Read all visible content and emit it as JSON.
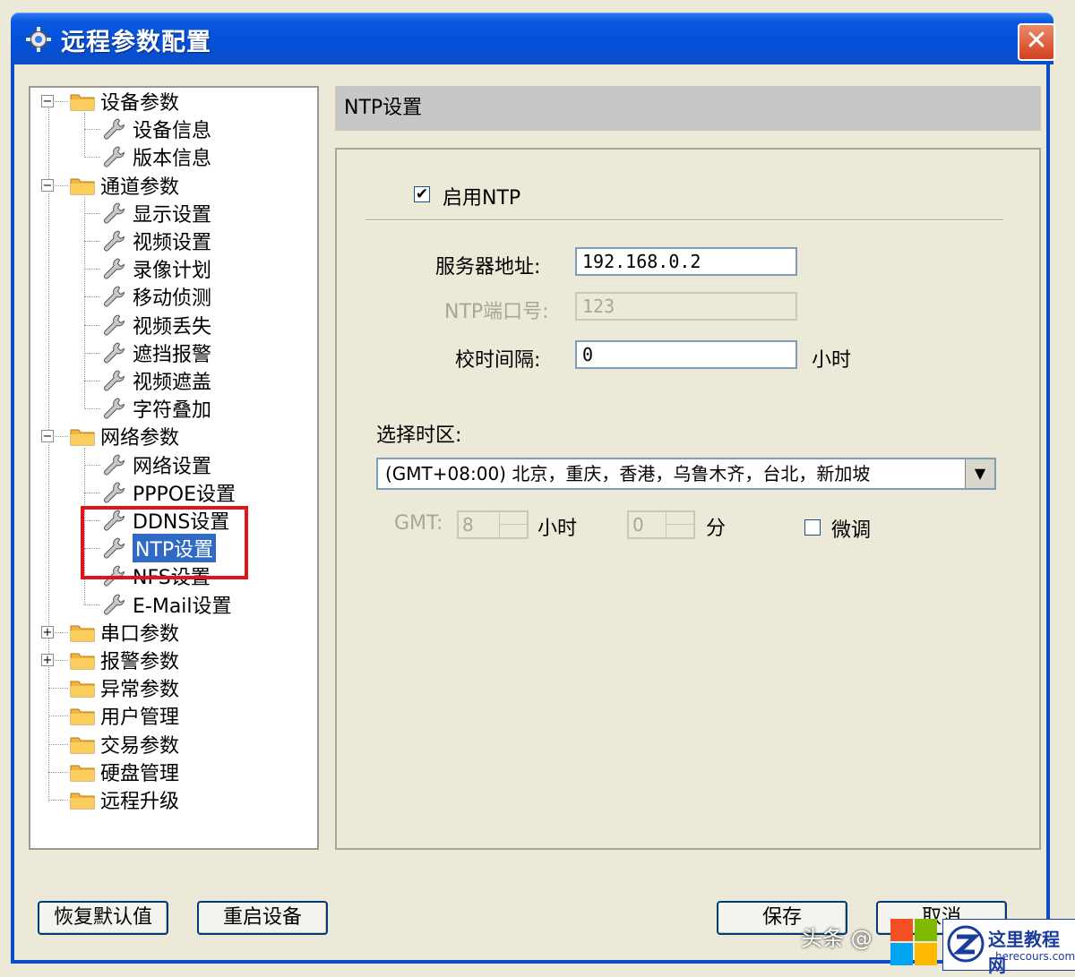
{
  "window": {
    "title": "远程参数配置"
  },
  "tree": {
    "items": [
      {
        "label": "设备参数"
      },
      {
        "label": "设备信息"
      },
      {
        "label": "版本信息"
      },
      {
        "label": "通道参数"
      },
      {
        "label": "显示设置"
      },
      {
        "label": "视频设置"
      },
      {
        "label": "录像计划"
      },
      {
        "label": "移动侦测"
      },
      {
        "label": "视频丢失"
      },
      {
        "label": "遮挡报警"
      },
      {
        "label": "视频遮盖"
      },
      {
        "label": "字符叠加"
      },
      {
        "label": "网络参数"
      },
      {
        "label": "网络设置"
      },
      {
        "label": "PPPOE设置"
      },
      {
        "label": "DDNS设置"
      },
      {
        "label": "NTP设置"
      },
      {
        "label": "NFS设置"
      },
      {
        "label": "E-Mail设置"
      },
      {
        "label": "串口参数"
      },
      {
        "label": "报警参数"
      },
      {
        "label": "异常参数"
      },
      {
        "label": "用户管理"
      },
      {
        "label": "交易参数"
      },
      {
        "label": "硬盘管理"
      },
      {
        "label": "远程升级"
      }
    ]
  },
  "panel": {
    "header": "NTP设置",
    "enable_ntp_label": "启用NTP",
    "server_label": "服务器地址:",
    "server_value": "192.168.0.2",
    "port_label": "NTP端口号:",
    "port_value": "123",
    "interval_label": "校时间隔:",
    "interval_value": "0",
    "interval_unit": "小时",
    "timezone_label": "选择时区:",
    "timezone_value": "(GMT+08:00) 北京，重庆，香港，乌鲁木齐，台北，新加坡",
    "gmt_label": "GMT:",
    "gmt_hours_value": "8",
    "hours_unit": "小时",
    "gmt_minutes_value": "0",
    "minutes_unit": "分",
    "fine_tune_label": "微调"
  },
  "buttons": {
    "restore_defaults": "恢复默认值",
    "reboot_device": "重启设备",
    "save": "保存",
    "cancel": "取消"
  },
  "watermark": {
    "text": "头条 @",
    "logo_title": "这里教程网",
    "logo_url": "herecours.com"
  },
  "colors": {
    "titlebar": "#0350d8",
    "selection": "#316ac5",
    "highlight_box": "#e0141a"
  }
}
